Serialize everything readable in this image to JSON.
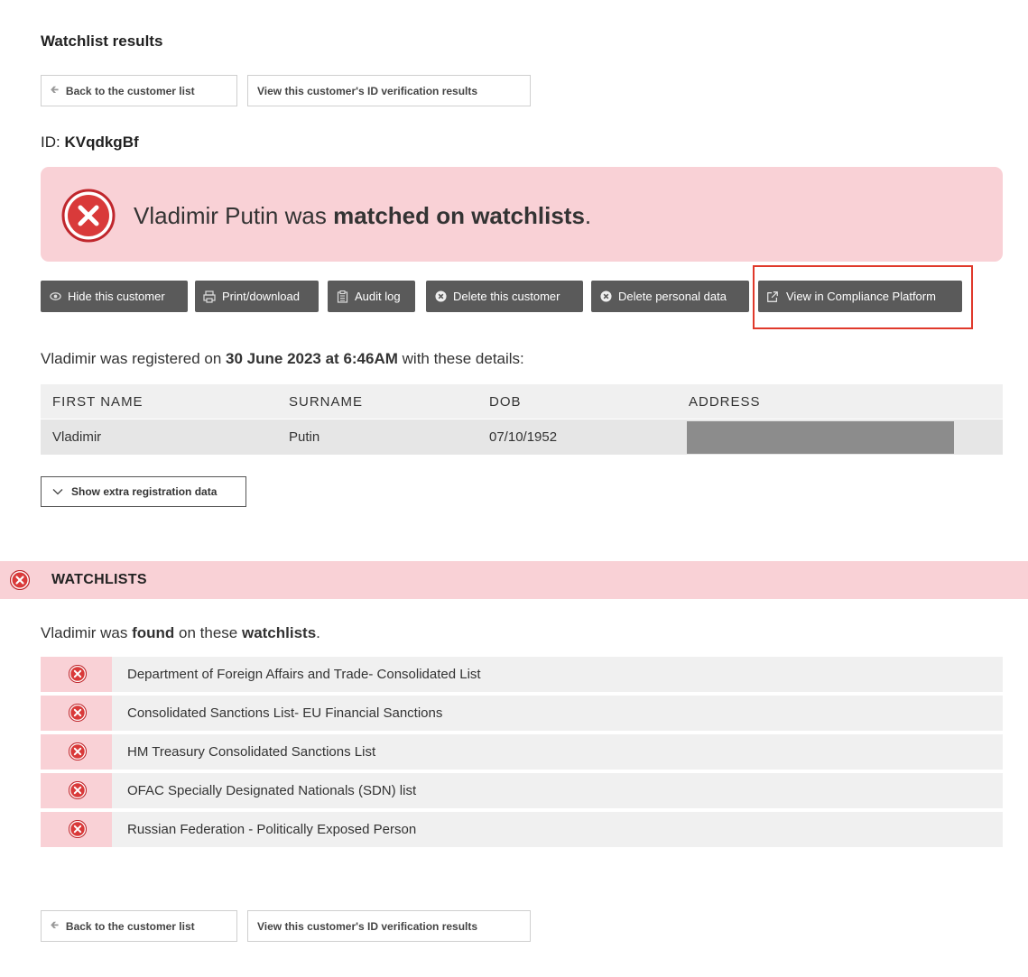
{
  "page": {
    "title": "Watchlist results"
  },
  "nav": {
    "back_label": "Back to the customer list",
    "id_verification_label": "View this customer's ID verification results"
  },
  "customer": {
    "id_prefix": "ID:",
    "id_value": "KVqdkgBf",
    "full_name": "Vladimir Putin",
    "first_name": "Vladimir"
  },
  "alert": {
    "text_before": "Vladimir Putin was ",
    "text_bold": "matched on watchlists",
    "text_after": "."
  },
  "actions": [
    {
      "label": "Hide this customer",
      "icon": "eye-icon"
    },
    {
      "label": "Print/download",
      "icon": "printer-icon"
    },
    {
      "label": "Audit log",
      "icon": "clipboard-icon"
    },
    {
      "label": "Delete this customer",
      "icon": "x-circle-icon"
    },
    {
      "label": "Delete personal data",
      "icon": "x-circle-icon"
    },
    {
      "label": "View in Compliance Platform",
      "icon": "external-link-icon"
    }
  ],
  "registration": {
    "text_before": "Vladimir was registered on ",
    "text_bold": "30 June 2023 at 6:46AM",
    "text_after": " with these details:",
    "columns": [
      "FIRST NAME",
      "SURNAME",
      "DOB",
      "ADDRESS"
    ],
    "row": {
      "first_name": "Vladimir",
      "surname": "Putin",
      "dob": "07/10/1952",
      "address": ""
    },
    "show_extra_label": "Show extra registration data"
  },
  "watchlists": {
    "section_title": "WATCHLISTS",
    "found_before": "Vladimir was ",
    "found_bold1": "found",
    "found_middle": " on these ",
    "found_bold2": "watchlists",
    "found_after": ".",
    "items": [
      "Department of Foreign Affairs and Trade- Consolidated List",
      "Consolidated Sanctions List- EU Financial Sanctions",
      "HM Treasury Consolidated Sanctions List",
      "OFAC Specially Designated Nationals (SDN) list",
      "Russian Federation - Politically Exposed Person"
    ]
  },
  "colors": {
    "alert_bg": "#f9d1d6",
    "danger_red": "#d93a3a",
    "dark_button": "#5a5a5a",
    "highlight_border": "#e0392b"
  }
}
